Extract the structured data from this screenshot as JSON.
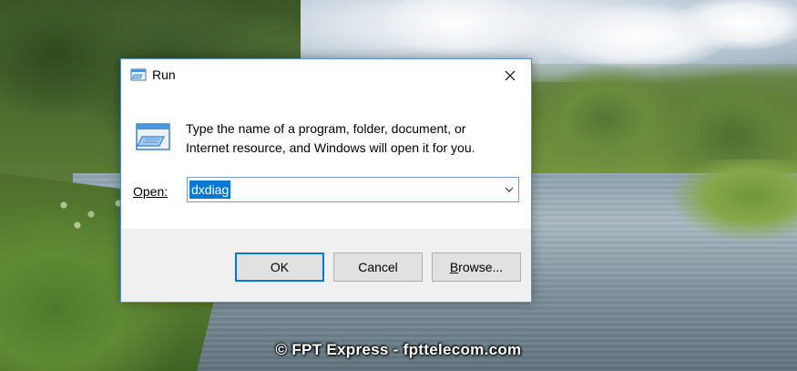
{
  "dialog": {
    "title": "Run",
    "close_icon": "close-icon",
    "app_icon": "run-icon",
    "description_line1": "Type the name of a program, folder, document, or",
    "description_line2": "Internet resource, and Windows will open it for you.",
    "open_label": "Open:",
    "open_value": "dxdiag",
    "dropdown_icon": "chevron-down-icon"
  },
  "buttons": {
    "ok": "OK",
    "cancel": "Cancel",
    "browse_prefix": "",
    "browse_underlined": "B",
    "browse_rest": "rowse..."
  },
  "watermark": "© FPT Express - fpttelecom.com",
  "colors": {
    "accent": "#0078d7",
    "dialog_border": "#5a8fcf",
    "footer_bg": "#f0f0f0",
    "button_bg": "#e1e1e1"
  }
}
